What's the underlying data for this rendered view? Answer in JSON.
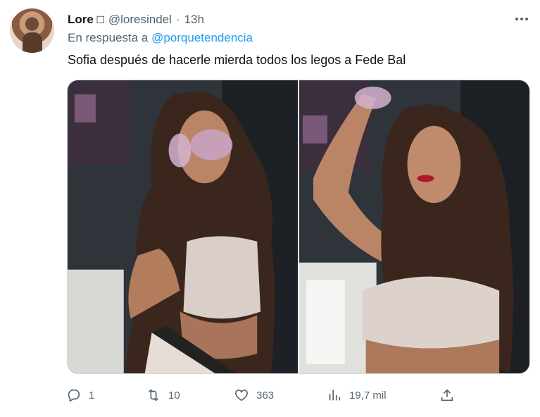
{
  "tweet": {
    "author_name": "Lore",
    "author_name_suffix": "□",
    "handle": "@loresindel",
    "separator": "·",
    "time": "13h",
    "reply_prefix": "En respuesta a",
    "reply_to": "@porquetendencia",
    "text": "Sofia después de hacerle mierda todos los legos a Fede Bal"
  },
  "actions": {
    "replies": "1",
    "retweets": "10",
    "likes": "363",
    "views": "19,7 mil"
  },
  "colors": {
    "link": "#1d9bf0",
    "muted": "#536471",
    "text": "#0f1419"
  }
}
